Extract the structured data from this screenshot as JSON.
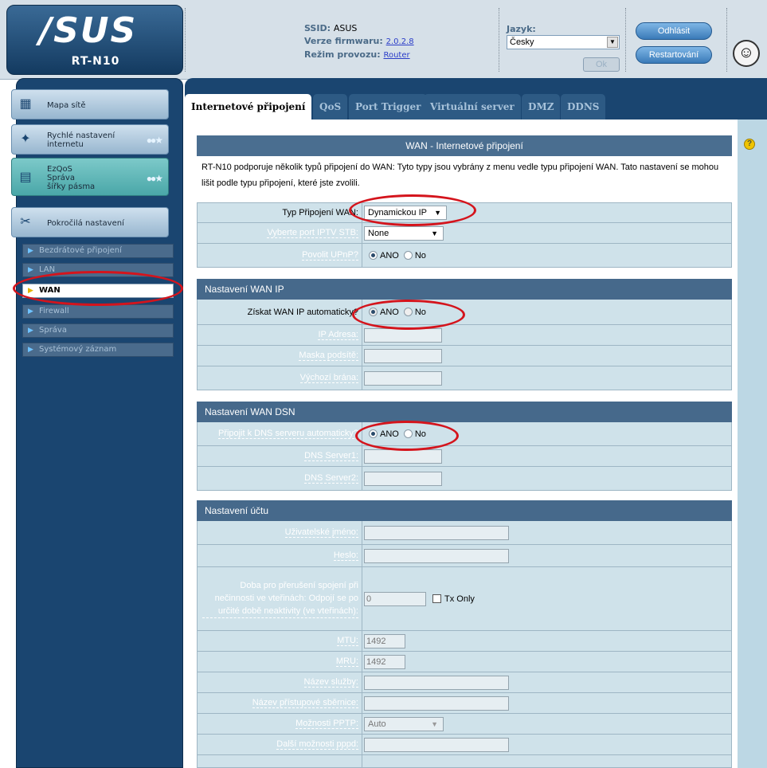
{
  "header": {
    "logo": "/SUS",
    "model": "RT-N10",
    "ssid_label": "SSID:",
    "ssid_value": "ASUS",
    "firmware_label": "Verze firmwaru:",
    "firmware_value": "2.0.2.8",
    "mode_label": "Režim provozu:",
    "mode_value": "Router",
    "language_label": "Jazyk:",
    "language_value": "Česky",
    "ok_label": "Ok",
    "logout_label": "Odhlásit",
    "restart_label": "Restartování"
  },
  "sidebar": {
    "network_map": "Mapa sítě",
    "quick_setup_1": "Rychlé nastavení",
    "quick_setup_2": "internetu",
    "ezqos_1": "EzQoS",
    "ezqos_2": "Správa",
    "ezqos_3": "šířky pásma",
    "advanced": "Pokročilá nastavení",
    "sub": [
      "Bezdrátové připojení",
      "LAN",
      "WAN",
      "Firewall",
      "Správa",
      "Systémový záznam"
    ]
  },
  "tabs": [
    "Internetové připojení",
    "QoS",
    "Port Trigger",
    "Virtuální server",
    "DMZ",
    "DDNS"
  ],
  "main": {
    "title": "WAN - Internetové připojení",
    "description": "RT-N10 podporuje několik typů připojení do WAN: Tyto typy jsou vybrány z menu vedle typu připojení WAN. Tato nastavení se mohou lišit podle typu připojení, které jste zvolili.",
    "conn_type_label": "Typ Připojení WAN:",
    "conn_type_value": "Dynamickou IP",
    "iptv_label": "Vyberte port IPTV STB:",
    "iptv_value": "None",
    "upnp_label": "Povolit UPnP?",
    "yes": "ANO",
    "no": "No",
    "wan_ip_header": "Nastavení WAN IP",
    "auto_ip_label": "Získat WAN IP automaticky?",
    "ip_label": "IP Adresa:",
    "mask_label": "Maska podsítě:",
    "gateway_label": "Výchozí brána:",
    "dns_header": "Nastavení WAN DSN",
    "auto_dns_label": "Připojit k DNS serveru automaticky?",
    "dns1_label": "DNS Server1:",
    "dns2_label": "DNS Server2:",
    "account_header": "Nastavení účtu",
    "username_label": "Uživatelské jméno:",
    "password_label": "Heslo:",
    "idle_label": "Doba pro přerušení spojení při nečinnosti ve vteřinách: Odpojí se po určité době neaktivity (ve vteřinách):",
    "idle_value": "0",
    "tx_only": "Tx Only",
    "mtu_label": "MTU:",
    "mtu_value": "1492",
    "mru_label": "MRU:",
    "mru_value": "1492",
    "service_label": "Název služby:",
    "access_label": "Název přístupové sběrnice:",
    "pptp_label": "Možnosti PPTP:",
    "pptp_value": "Auto",
    "pppd_label": "Další možnosti pppd:"
  }
}
